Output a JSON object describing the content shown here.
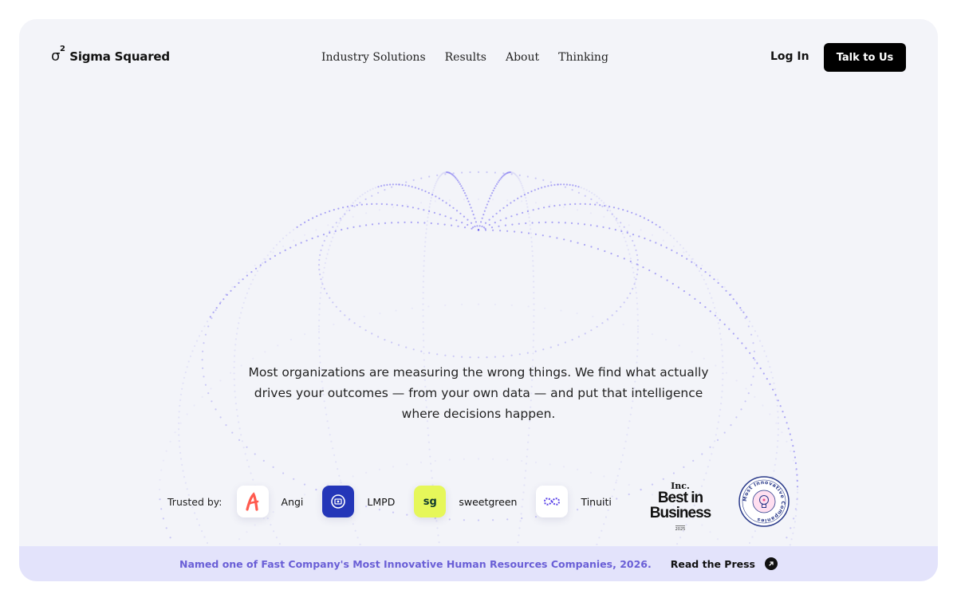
{
  "header": {
    "logo_mark": "σ",
    "logo_superscript": "2",
    "logo_text": "Sigma Squared",
    "nav": [
      "Industry Solutions",
      "Results",
      "About",
      "Thinking"
    ],
    "login": "Log In",
    "cta": "Talk to Us"
  },
  "hero": {
    "line1": "Most organizations are measuring the wrong things. We find what actually",
    "line2": "drives your outcomes — from your own data — and put that intelligence",
    "line3": "where decisions happen."
  },
  "trusted": {
    "label": "Trusted by:",
    "brands": [
      {
        "name": "Angi",
        "icon": "angi-logo-icon"
      },
      {
        "name": "LMPD",
        "icon": "lmpd-logo-icon"
      },
      {
        "name": "sweetgreen",
        "icon": "sweetgreen-logo-icon",
        "mark": "sg"
      },
      {
        "name": "Tinuiti",
        "icon": "tinuiti-logo-icon"
      }
    ],
    "award_inc": {
      "top": "Inc.",
      "mid1": "Best in",
      "mid2": "Business",
      "year": "2025"
    },
    "award_fc": "Most Innovative Companies"
  },
  "banner": {
    "text": "Named one of Fast Company's Most Innovative Human Resources Companies, 2026.",
    "press": "Read the Press",
    "press_icon": "arrow-up-right-icon"
  },
  "colors": {
    "background": "#f3f4f9",
    "banner": "#e3e3fb",
    "banner_text": "#6a5fd6",
    "globe_dots": "#6e63f0",
    "cta": "#000000"
  }
}
